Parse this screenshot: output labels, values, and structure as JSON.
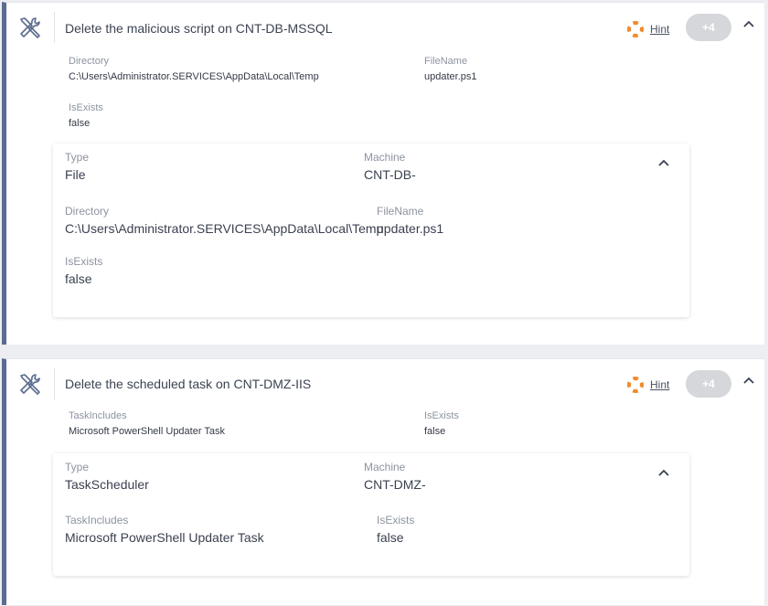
{
  "colors": {
    "accent_border": "#5b6d8e",
    "hint_icon": "#f08a2a",
    "badge_bg": "#d5d7db"
  },
  "tasks": [
    {
      "icon": "tools-icon",
      "title": "Delete the malicious script on CNT-DB-MSSQL",
      "hint_label": "Hint",
      "badge": "+4",
      "fields": [
        {
          "label": "Directory",
          "value": "C:\\Users\\Administrator.SERVICES\\AppData\\Local\\Temp"
        },
        {
          "label": "FileName",
          "value": "updater.ps1"
        },
        {
          "label": "IsExists",
          "value": "false"
        }
      ],
      "detail": {
        "type_label": "Type",
        "type_value": "File",
        "machine_label": "Machine",
        "machine_value": "CNT-DB-",
        "fields": [
          {
            "label": "Directory",
            "value": "C:\\Users\\Administrator.SERVICES\\AppData\\Local\\Temp"
          },
          {
            "label": "FileName",
            "value": "updater.ps1"
          },
          {
            "label": "IsExists",
            "value": "false"
          }
        ]
      }
    },
    {
      "icon": "tools-icon",
      "title": "Delete the scheduled task on CNT-DMZ-IIS",
      "hint_label": "Hint",
      "badge": "+4",
      "fields": [
        {
          "label": "TaskIncludes",
          "value": "Microsoft PowerShell Updater Task"
        },
        {
          "label": "IsExists",
          "value": "false"
        }
      ],
      "detail": {
        "type_label": "Type",
        "type_value": "TaskScheduler",
        "machine_label": "Machine",
        "machine_value": "CNT-DMZ-",
        "fields": [
          {
            "label": "TaskIncludes",
            "value": "Microsoft PowerShell Updater Task"
          },
          {
            "label": "IsExists",
            "value": "false"
          }
        ]
      }
    }
  ]
}
